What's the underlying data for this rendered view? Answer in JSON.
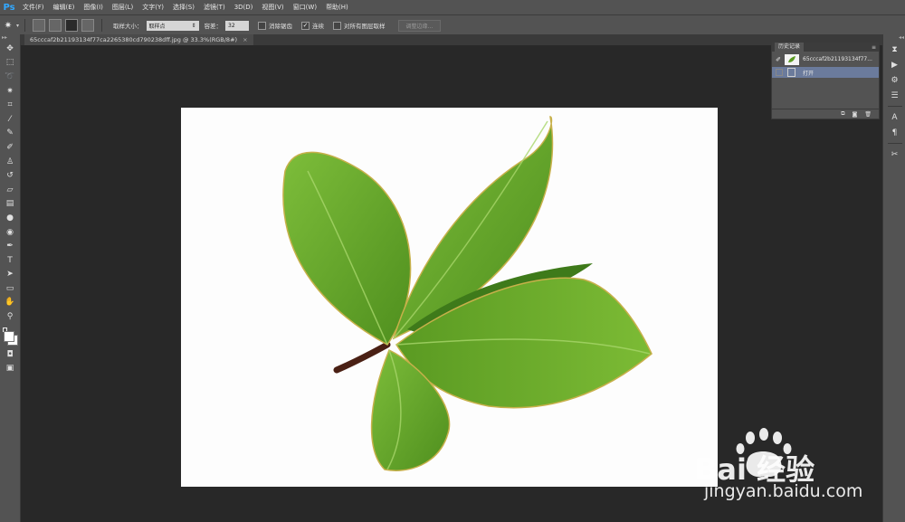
{
  "app": {
    "logo": "Ps"
  },
  "menu": [
    "文件(F)",
    "编辑(E)",
    "图像(I)",
    "图层(L)",
    "文字(Y)",
    "选择(S)",
    "滤镜(T)",
    "3D(D)",
    "视图(V)",
    "窗口(W)",
    "帮助(H)"
  ],
  "options": {
    "sample_size_label": "取样大小：",
    "sample_size_value": "取样点",
    "tolerance_label": "容差：",
    "tolerance_value": "32",
    "antialias_label": "消除锯齿",
    "antialias_checked": false,
    "contiguous_label": "连续",
    "contiguous_checked": true,
    "sample_all_layers_label": "对所有图层取样",
    "sample_all_layers_checked": false,
    "refine_edge_label": "调整边缘..."
  },
  "document": {
    "tab_title": "65cccaf2b21193134f77ca2265380cd790238dff.jpg @ 33.3%(RGB/8#)",
    "close_glyph": "×"
  },
  "history_panel": {
    "title": "历史记录",
    "snapshot_label": "65cccaf2b21193134f77...",
    "step_label": "打开"
  },
  "watermark": {
    "brand_text": "Bai 经验",
    "url": "jingyan.baidu.com"
  },
  "colors": {
    "ui_dark": "#282828",
    "ui_panel": "#535353",
    "leaf_green": "#6aab2c",
    "history_selected": "#6b7b9c"
  },
  "tools_icons": [
    "move-icon",
    "marquee-icon",
    "lasso-icon",
    "magic-wand-icon",
    "crop-icon",
    "eyedropper-icon",
    "healing-brush-icon",
    "brush-icon",
    "clone-stamp-icon",
    "history-brush-icon",
    "eraser-icon",
    "gradient-icon",
    "blur-icon",
    "dodge-icon",
    "pen-icon",
    "type-icon",
    "path-selection-icon",
    "shape-icon",
    "hand-icon",
    "zoom-icon"
  ]
}
